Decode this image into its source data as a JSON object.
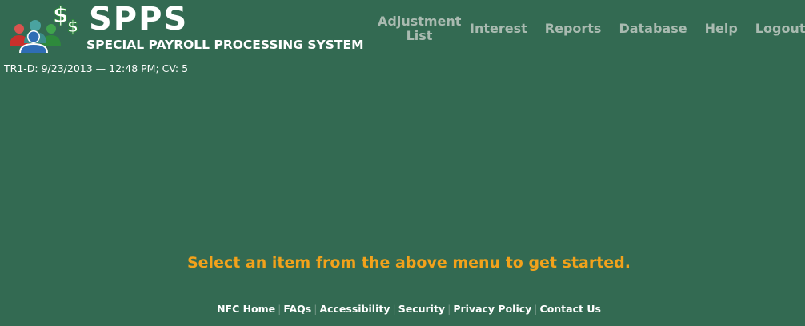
{
  "app": {
    "title": "SPPS",
    "subtitle": "SPECIAL PAYROLL PROCESSING SYSTEM"
  },
  "nav": {
    "items": [
      {
        "label": "Adjustment List"
      },
      {
        "label": "Interest"
      },
      {
        "label": "Reports"
      },
      {
        "label": "Database"
      },
      {
        "label": "Help"
      },
      {
        "label": "Logout"
      }
    ]
  },
  "status": {
    "text": "TR1-D: 9/23/2013 — 12:48 PM; CV: 5"
  },
  "main": {
    "prompt": "Select an item from the above menu to get started."
  },
  "footer": {
    "links": [
      {
        "label": "NFC Home"
      },
      {
        "label": "FAQs"
      },
      {
        "label": "Accessibility"
      },
      {
        "label": "Security"
      },
      {
        "label": "Privacy Policy"
      },
      {
        "label": "Contact Us"
      }
    ],
    "separator": "|"
  },
  "colors": {
    "background": "#336A52",
    "nav_text": "#a9bab0",
    "prompt_text": "#F2A21B"
  }
}
